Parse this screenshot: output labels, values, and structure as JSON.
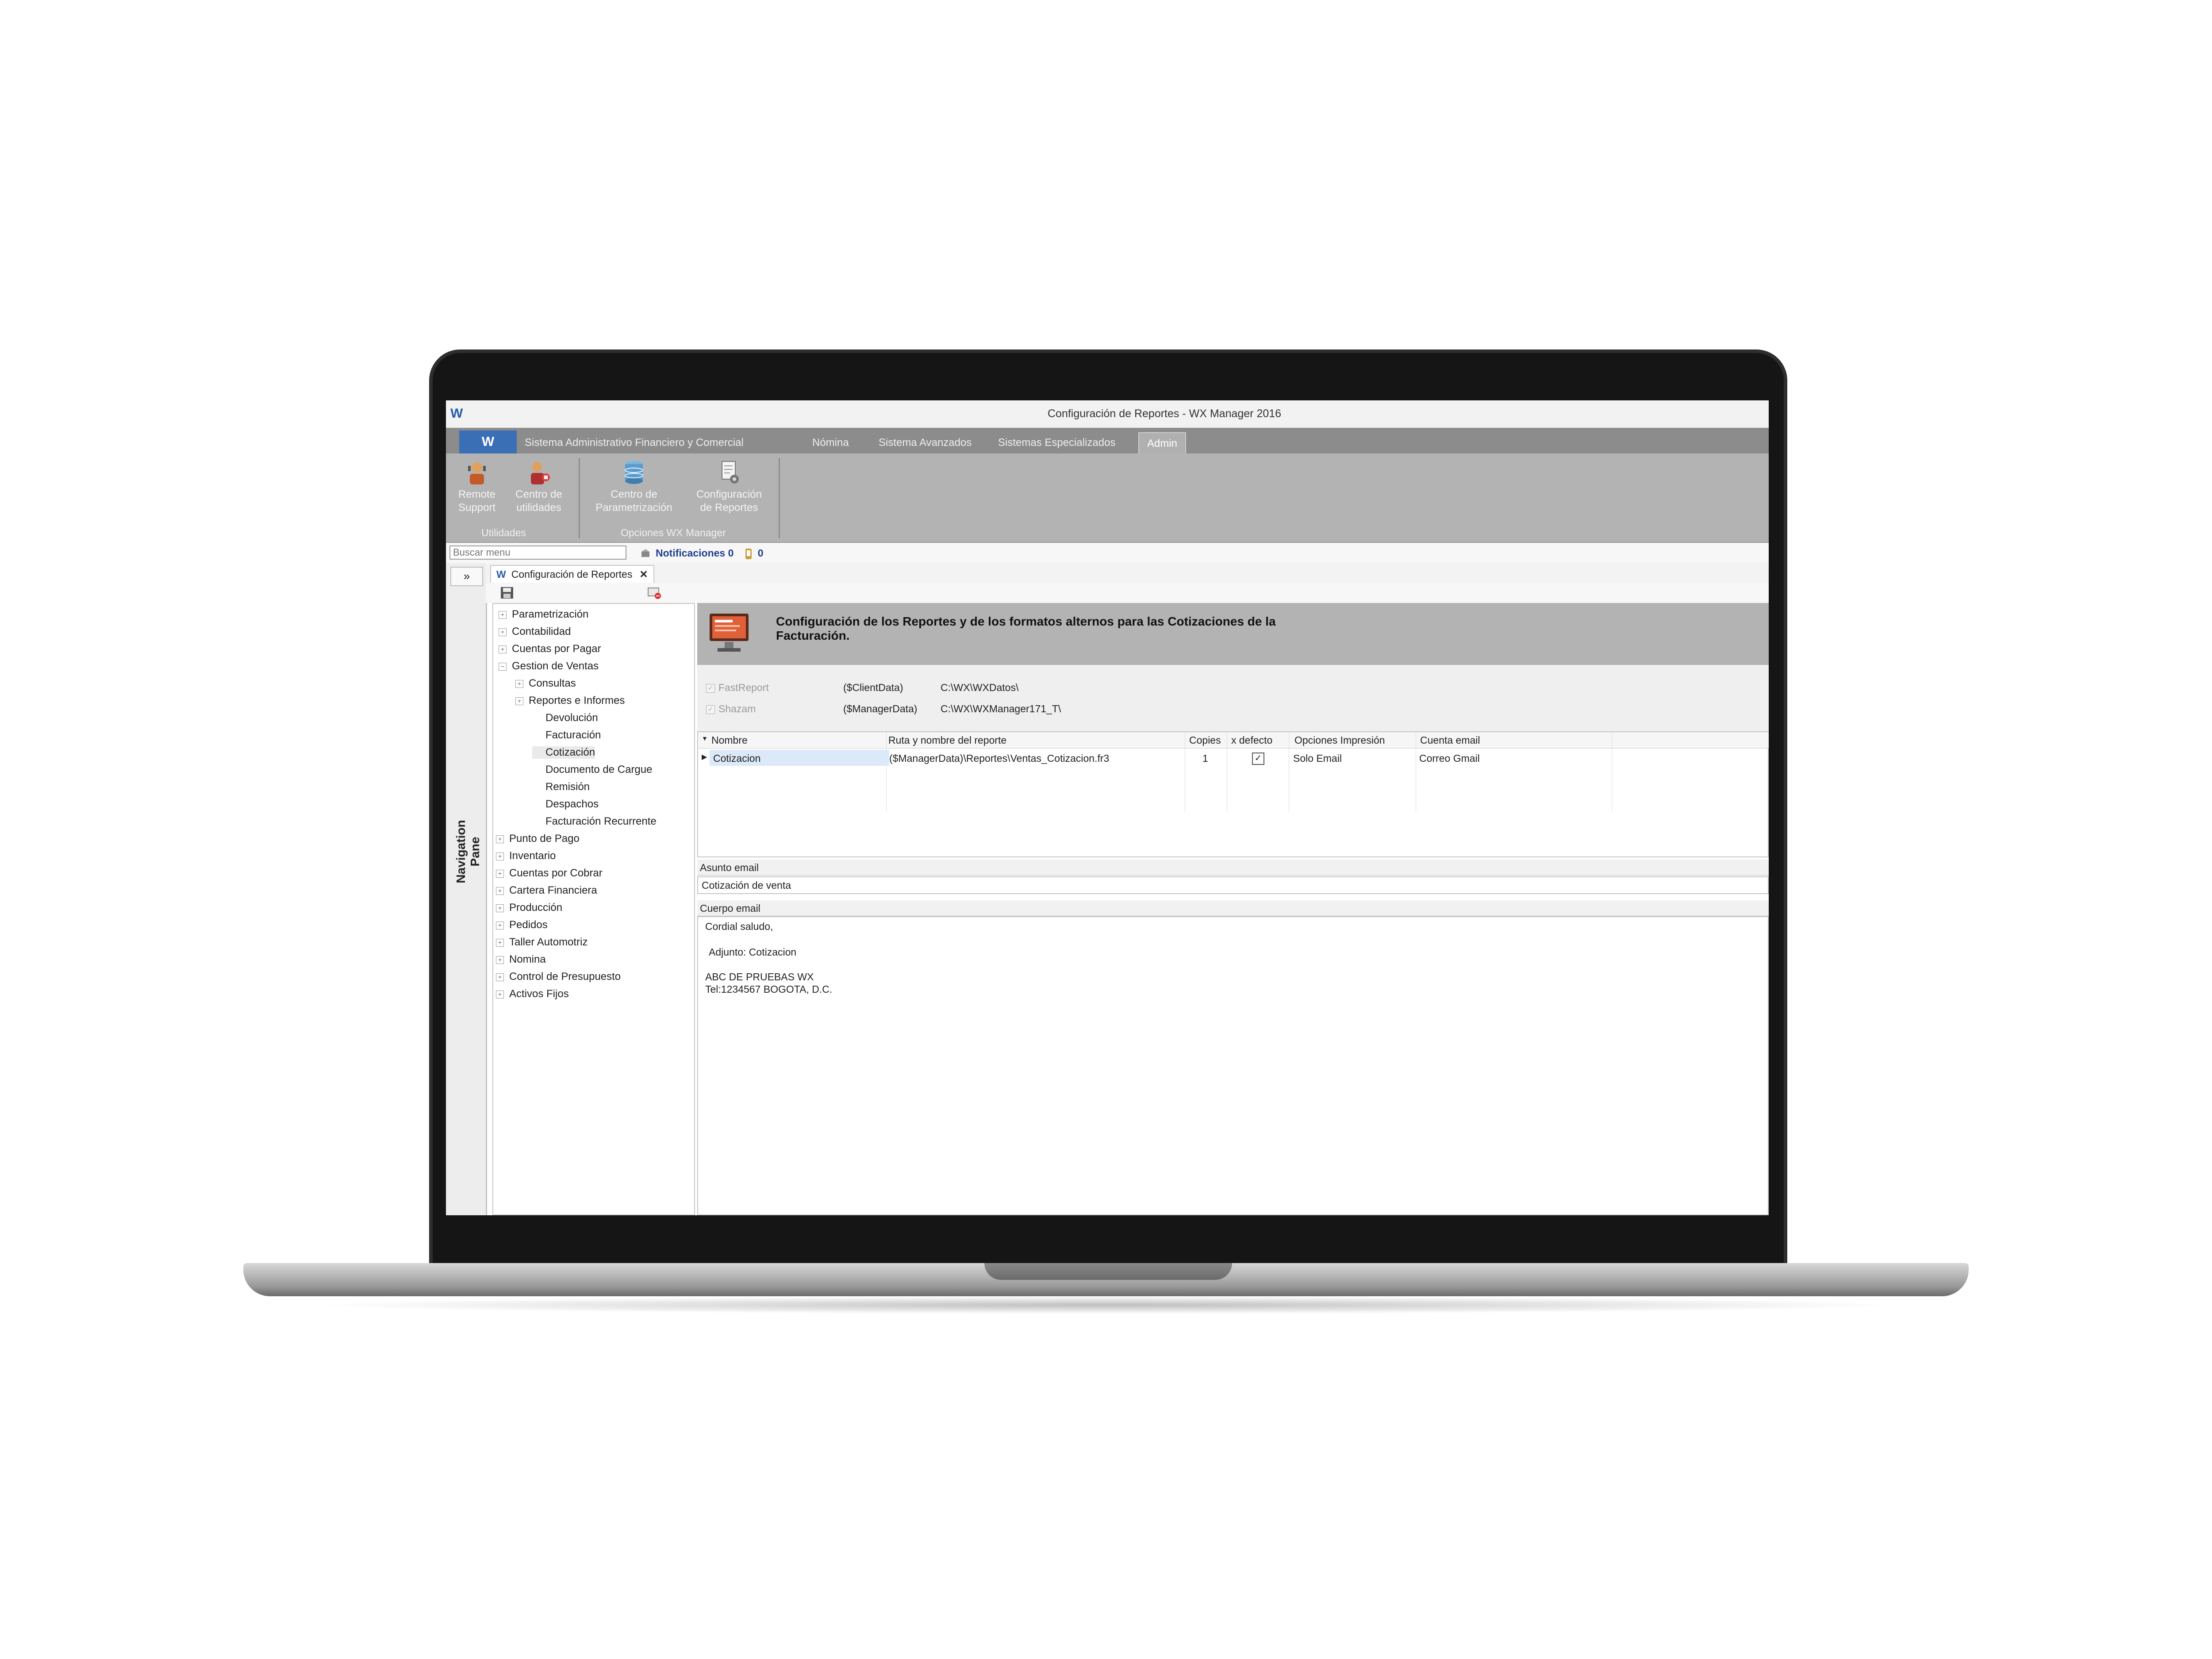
{
  "window": {
    "title": "Configuración de Reportes - WX Manager 2016",
    "logo": "W"
  },
  "ribbon": {
    "app_button": "W",
    "tabs": [
      "Sistema Administrativo Financiero y Comercial",
      "Nómina",
      "Sistema Avanzados",
      "Sistemas Especializados",
      "Admin"
    ],
    "active_tab": "Admin",
    "groups": [
      {
        "label": "Utilidades",
        "buttons": [
          {
            "line1": "Remote",
            "line2": "Support",
            "icon": "remote-support-icon"
          },
          {
            "line1": "Centro de",
            "line2": "utilidades",
            "icon": "utilities-icon"
          }
        ]
      },
      {
        "label": "Opciones WX Manager",
        "buttons": [
          {
            "line1": "Centro de",
            "line2": "Parametrización",
            "icon": "database-icon"
          },
          {
            "line1": "Configuración",
            "line2": "de Reportes",
            "icon": "report-config-icon"
          }
        ]
      }
    ]
  },
  "search": {
    "placeholder": "Buscar menu"
  },
  "notifications": {
    "label": "Notificaciones 0",
    "count": "0"
  },
  "nav_pane": {
    "label": "Navigation Pane",
    "toggle": "»"
  },
  "doc_tab": {
    "icon": "W",
    "label": "Configuración de Reportes",
    "close": "✕"
  },
  "tree": [
    {
      "label": "Parametrización",
      "expander": "+"
    },
    {
      "label": "Contabilidad",
      "expander": "+"
    },
    {
      "label": "Cuentas por Pagar",
      "expander": "+"
    },
    {
      "label": "Gestion de Ventas",
      "expander": "−"
    },
    {
      "label": "Consultas",
      "expander": "+"
    },
    {
      "label": "Reportes e Informes",
      "expander": "+"
    },
    {
      "label": "Devolución",
      "expander": ""
    },
    {
      "label": "Facturación",
      "expander": ""
    },
    {
      "label": "Cotización",
      "expander": ""
    },
    {
      "label": "Documento de Cargue",
      "expander": ""
    },
    {
      "label": "Remisión",
      "expander": ""
    },
    {
      "label": "Despachos",
      "expander": ""
    },
    {
      "label": "Facturación Recurrente",
      "expander": ""
    },
    {
      "label": "Punto de Pago",
      "expander": "+"
    },
    {
      "label": "Inventario",
      "expander": "+"
    },
    {
      "label": "Cuentas por Cobrar",
      "expander": "+"
    },
    {
      "label": "Cartera Financiera",
      "expander": "+"
    },
    {
      "label": "Producción",
      "expander": "+"
    },
    {
      "label": "Pedidos",
      "expander": "+"
    },
    {
      "label": "Taller Automotriz",
      "expander": "+"
    },
    {
      "label": "Nomina",
      "expander": "+"
    },
    {
      "label": "Control de Presupuesto",
      "expander": "+"
    },
    {
      "label": "Activos Fijos",
      "expander": "+"
    }
  ],
  "header": {
    "text": "Configuración de los Reportes y de los formatos alternos para las Cotizaciones de la Facturación."
  },
  "options": [
    {
      "label": "FastReport",
      "var": "($ClientData)",
      "path": "C:\\WX\\WXDatos\\",
      "checked": true
    },
    {
      "label": "Shazam",
      "var": "($ManagerData)",
      "path": "C:\\WX\\WXManager171_T\\",
      "checked": true
    }
  ],
  "grid": {
    "columns": [
      "Nombre",
      "Ruta y nombre del reporte",
      "Copies",
      "x defecto",
      "Opciones Impresión",
      "Cuenta email"
    ],
    "rows": [
      {
        "nombre": "Cotizacion",
        "ruta": "($ManagerData)\\Reportes\\Ventas_Cotizacion.fr3",
        "copies": "1",
        "defecto": "✓",
        "opciones": "Solo Email",
        "cuenta": "Correo Gmail"
      }
    ]
  },
  "email": {
    "subject_label": "Asunto email",
    "subject": "Cotización de venta",
    "body_label": "Cuerpo email",
    "body_lines": [
      "Cordial saludo,",
      "Adjunto: Cotizacion",
      "ABC DE PRUEBAS WX",
      "Tel:1234567 BOGOTA, D.C."
    ]
  },
  "colors": {
    "ribbon": "#b3b3b3",
    "tabs": "#8c8c8c",
    "accent": "#3a6fb6",
    "notification": "#1f3f8f"
  }
}
